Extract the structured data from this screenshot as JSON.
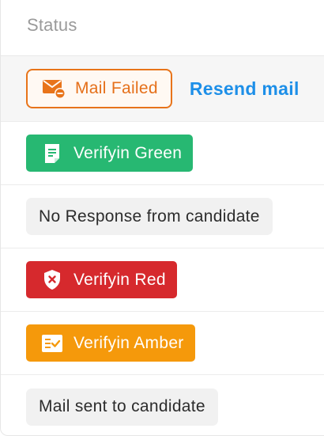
{
  "header": {
    "status_label": "Status"
  },
  "rows": [
    {
      "badge_label": "Mail Failed",
      "badge_icon": "mail-failed-icon",
      "badge_color": "#e8741a",
      "action_label": "Resend mail"
    },
    {
      "badge_label": "Verifyin Green",
      "badge_icon": "document-icon",
      "badge_color": "#27b872"
    },
    {
      "badge_label": "No Response from candidate"
    },
    {
      "badge_label": "Verifyin Red",
      "badge_icon": "shield-x-icon",
      "badge_color": "#d6292d"
    },
    {
      "badge_label": "Verifyin Amber",
      "badge_icon": "checklist-icon",
      "badge_color": "#f5990b"
    },
    {
      "badge_label": "Mail sent to candidate"
    }
  ]
}
